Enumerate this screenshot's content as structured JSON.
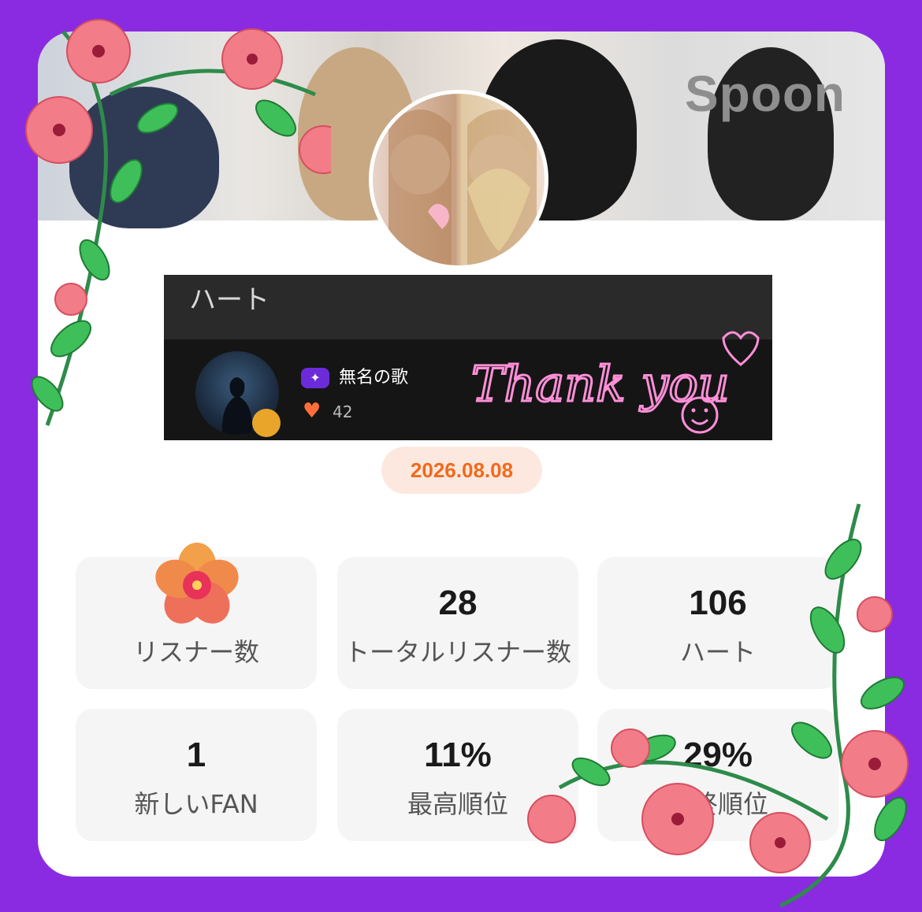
{
  "banner": {
    "logo_text": "Spoon"
  },
  "hearts_panel": {
    "title": "ハート",
    "user_name": "無名の歌",
    "heart_count": "42",
    "thank_you_text": "Thank you"
  },
  "date": "2026.08.08",
  "stats": [
    {
      "value": "",
      "label": "リスナー数",
      "icon": "hibiscus-icon"
    },
    {
      "value": "28",
      "label": "トータルリスナー数"
    },
    {
      "value": "106",
      "label": "ハート"
    },
    {
      "value": "1",
      "label": "新しいFAN"
    },
    {
      "value": "11%",
      "label": "最高順位"
    },
    {
      "value": "29%",
      "label": "最終順位"
    }
  ],
  "colors": {
    "frame": "#8a2be2",
    "date_text": "#f26a1b",
    "date_bg": "#fde8e0",
    "badge": "#6c2bd9",
    "heart": "#ff6e3a",
    "neon_pink": "#ff8fd8"
  }
}
